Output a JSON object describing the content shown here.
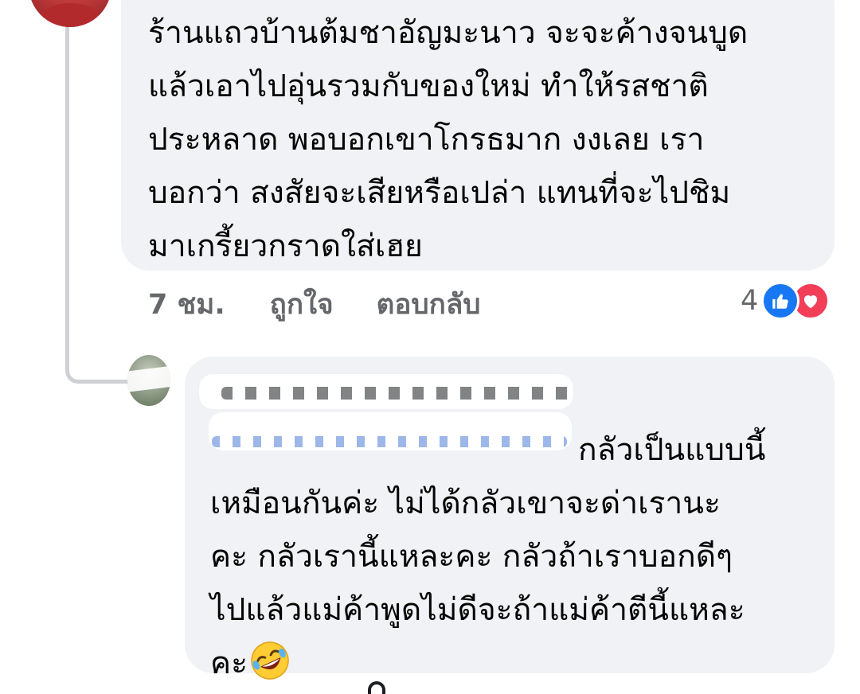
{
  "comment": {
    "lines": [
      "ร้านแถวบ้านต้มชาอัญมะนาว จะจะค้างจนบูด",
      "แล้วเอาไปอุ่นรวมกับของใหม่ ทำให้รสชาติ",
      "ประหลาด พอบอกเขาโกรธมาก งงเลย เรา",
      "บอกว่า สงสัยจะเสียหรือเปล่า แทนที่จะไปชิม",
      "มาเกรี้ยวกราดใส่เฮย"
    ],
    "time": "7 ชม.",
    "like_label": "ถูกใจ",
    "reply_label": "ตอบกลับ",
    "reaction_count": "4",
    "reactions": [
      "like-icon",
      "love-icon"
    ]
  },
  "reply": {
    "lines": [
      "กลัวเป็นแบบนี้",
      "เหมือนกันค่ะ ไม่ได้กลัวเขาจะด่าเรานะ",
      "คะ กลัวเรานี้แหละคะ กลัวถ้าเราบอกดีๆ",
      "ไปแล้วแม่ค้าพูดไม่ดีจะถ้าแม่ค้าตีนี้แหละ",
      "คะ"
    ],
    "emoji": "rolling-on-floor-laughing-emoji"
  },
  "colors": {
    "bubble": "#f0f2f5",
    "meta_text": "#65676b",
    "like_blue": "#1877f2",
    "love_red": "#f33e58",
    "thread_line": "#ced0d4"
  }
}
